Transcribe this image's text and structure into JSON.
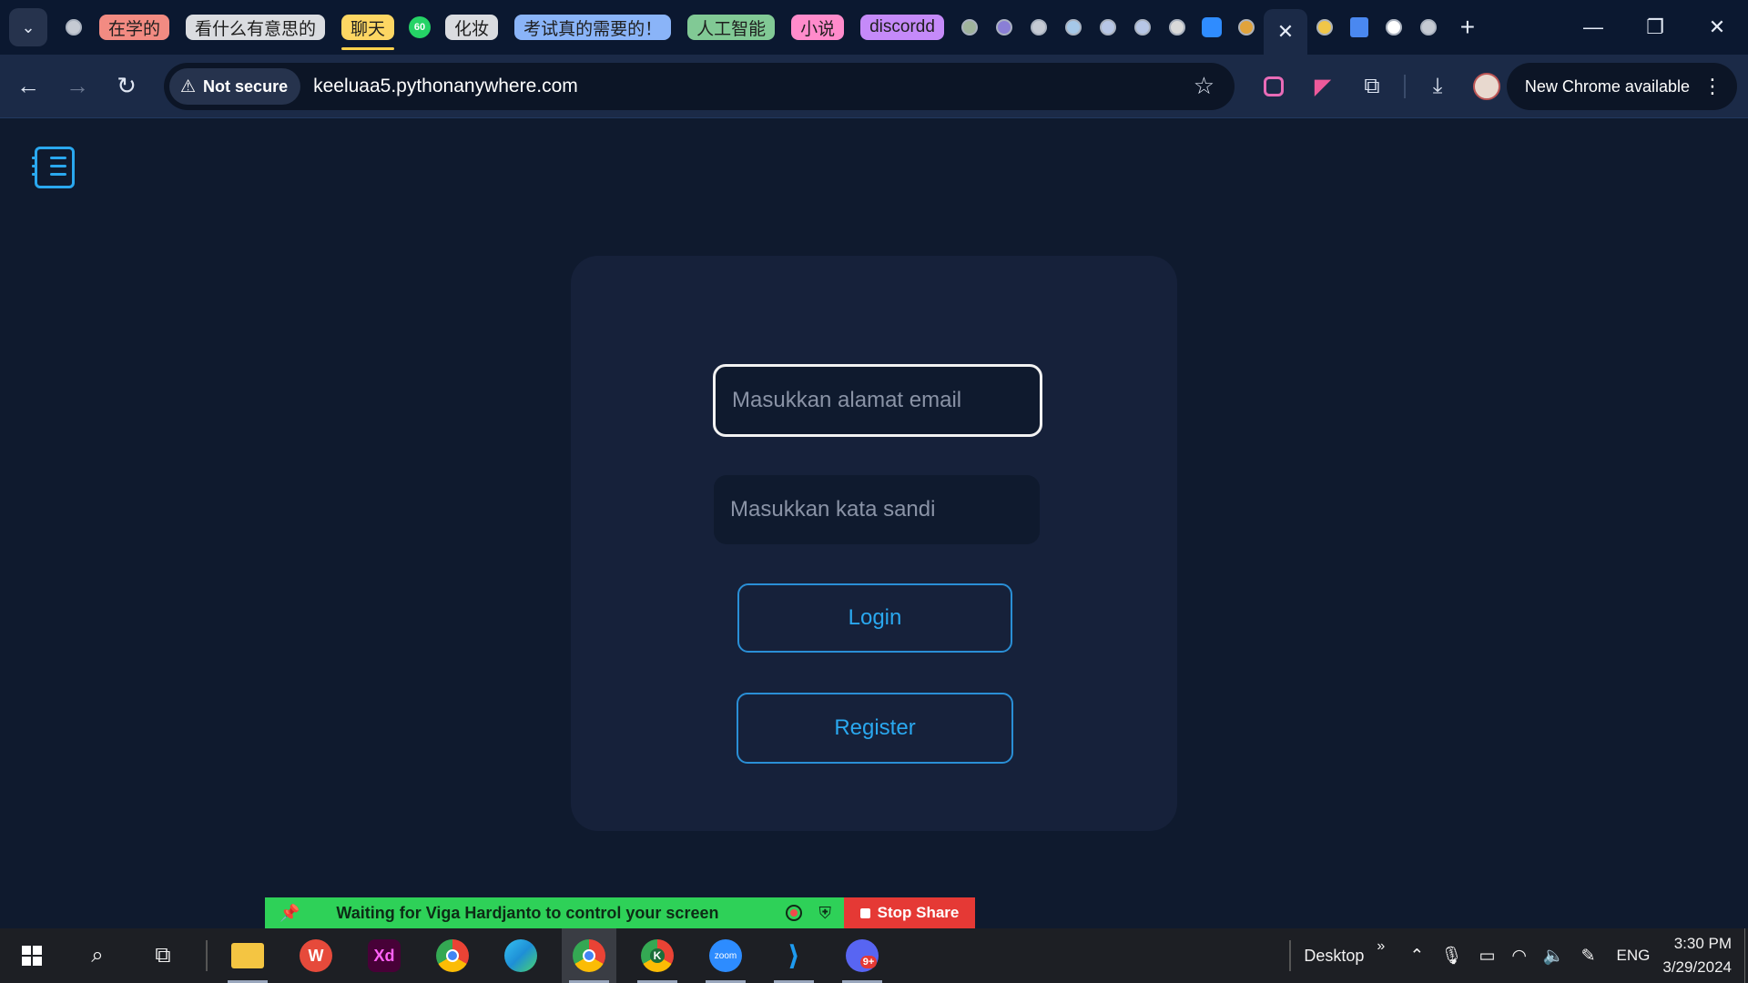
{
  "browser": {
    "tab_groups": [
      {
        "label": "在学的",
        "color": "#f28b82"
      },
      {
        "label": "看什么有意思的",
        "color": "#dadce0"
      },
      {
        "label": "聊天",
        "color": "#fdd663"
      },
      {
        "label": "化妆",
        "color": "#dadce0"
      },
      {
        "label": "考试真的需要的！",
        "color": "#8ab4f8"
      },
      {
        "label": "人工智能",
        "color": "#81c995"
      },
      {
        "label": "小说",
        "color": "#ff8bcb"
      },
      {
        "label": "discordd",
        "color": "#c58af9"
      }
    ],
    "badge_count": "60",
    "active_tab_close": "✕",
    "new_tab": "+",
    "window": {
      "minimize": "—",
      "restore": "❐",
      "close": "✕"
    }
  },
  "toolbar": {
    "security_label": "Not secure",
    "url": "keeluaa5.pythonanywhere.com",
    "update_label": "New Chrome available"
  },
  "login": {
    "email_placeholder": "Masukkan alamat email",
    "password_placeholder": "Masukkan kata sandi",
    "login_label": "Login",
    "register_label": "Register"
  },
  "share": {
    "message": "Waiting for Viga Hardjanto to control your screen",
    "stop_label": "Stop Share"
  },
  "taskbar": {
    "desktop_label": "Desktop",
    "language": "ENG",
    "time": "3:30 PM",
    "date": "3/29/2024",
    "apps": [
      {
        "name": "file-explorer",
        "label": "",
        "color": "#f4c542"
      },
      {
        "name": "wps-office",
        "label": "W",
        "color": "#e64a3b"
      },
      {
        "name": "adobe-xd",
        "label": "Xd",
        "color": "#470137"
      },
      {
        "name": "chrome",
        "label": "",
        "color": "#4285f4"
      },
      {
        "name": "edge",
        "label": "",
        "color": "#1e8fd6"
      },
      {
        "name": "chrome-profile",
        "label": "",
        "color": "#4285f4"
      },
      {
        "name": "chrome-k",
        "label": "K",
        "color": "#34a853"
      },
      {
        "name": "zoom",
        "label": "zoom",
        "color": "#2d8cff"
      },
      {
        "name": "vscode",
        "label": "",
        "color": "#0a7ad1"
      },
      {
        "name": "discord",
        "label": "9+",
        "color": "#5865f2"
      }
    ]
  }
}
